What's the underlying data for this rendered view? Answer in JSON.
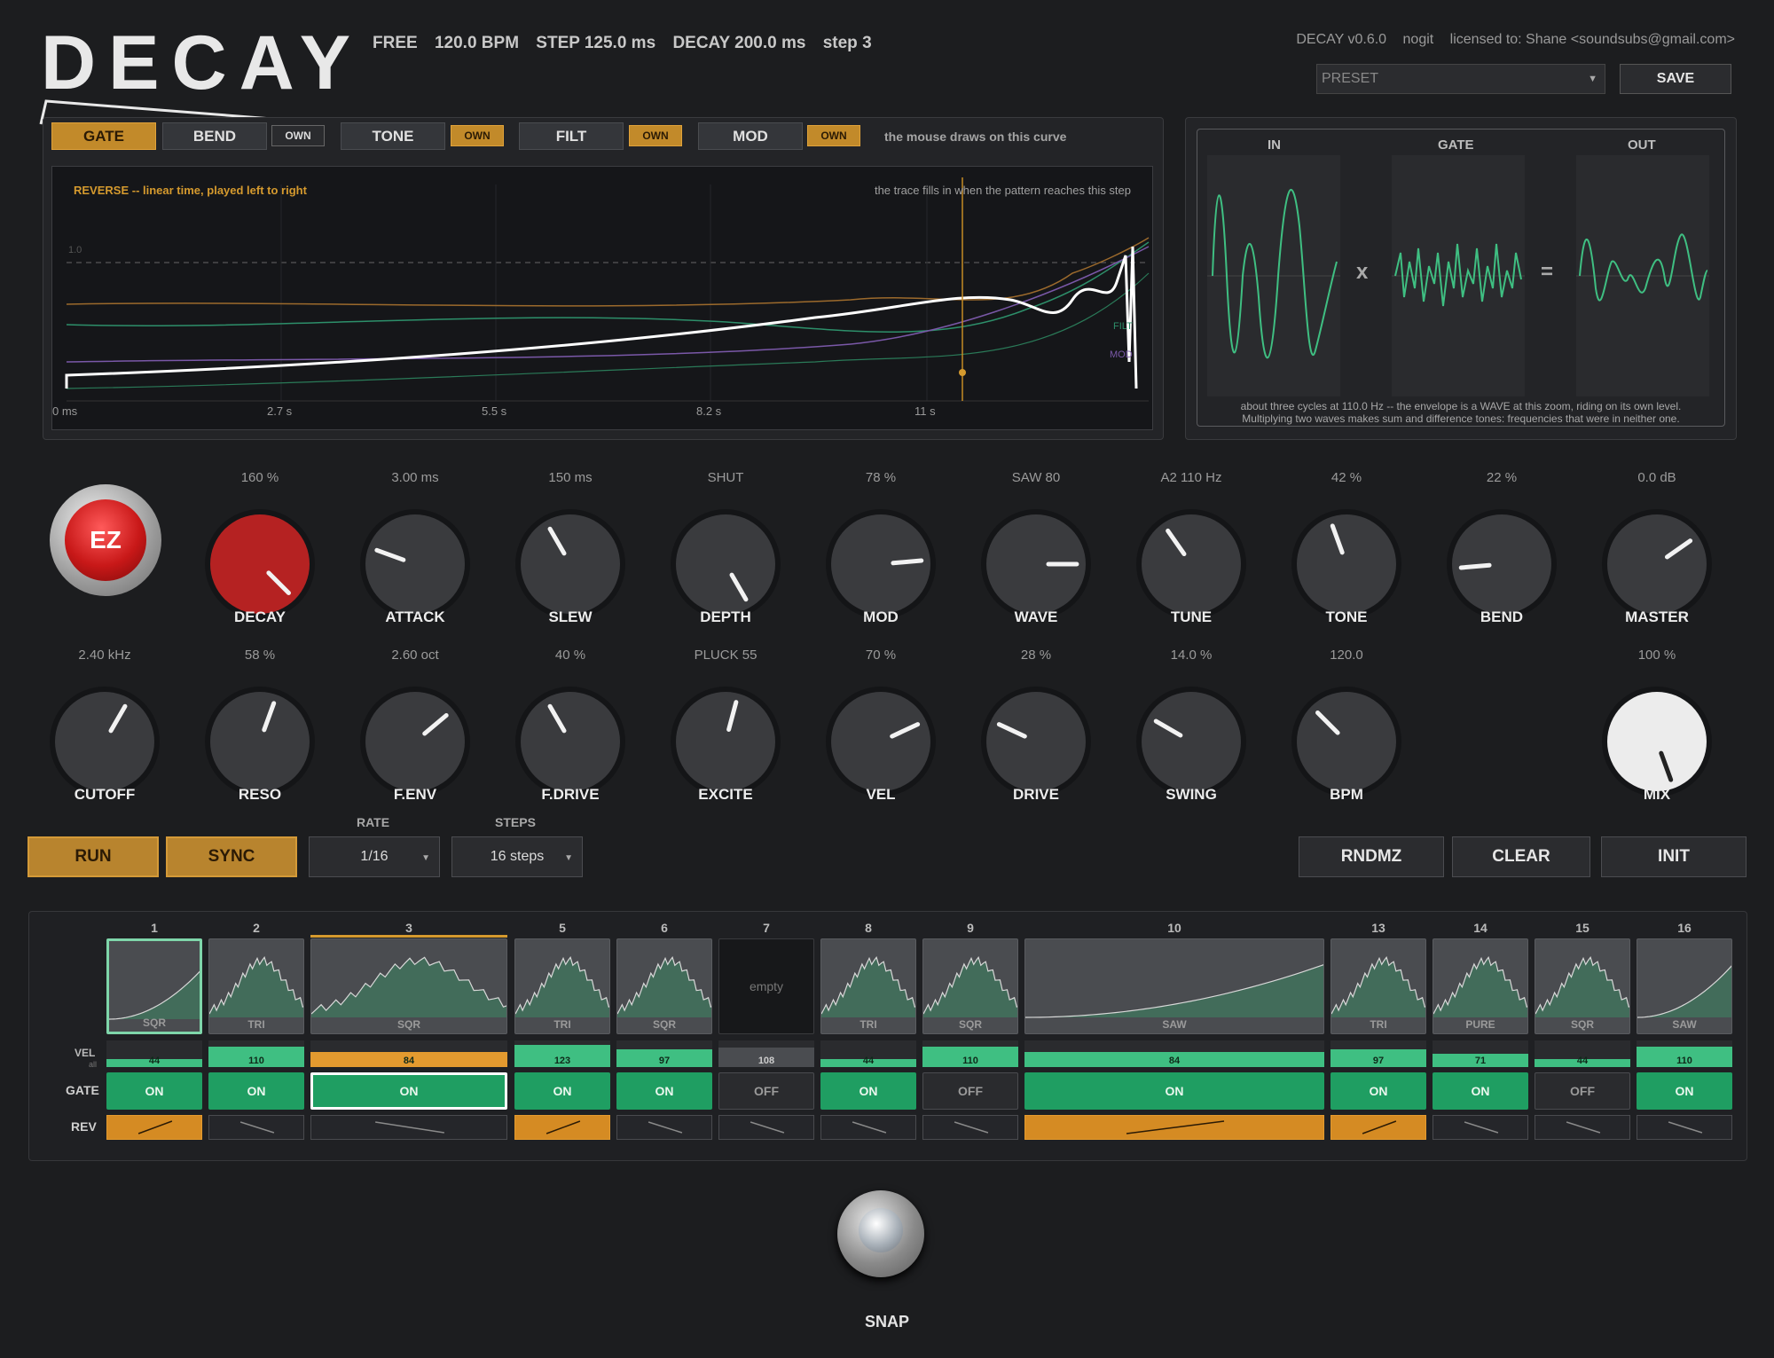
{
  "header": {
    "logo": "DECAY",
    "status": [
      "FREE",
      "120.0 BPM",
      "STEP 125.0 ms",
      "DECAY 200.0 ms",
      "step 3"
    ],
    "info": [
      "DECAY  v0.6.0",
      "nogit",
      "licensed to: Shane <soundsubs@gmail.com>"
    ],
    "preset_placeholder": "PRESET",
    "save_label": "SAVE"
  },
  "tabs": [
    {
      "label": "GATE",
      "active": true
    },
    {
      "label": "BEND",
      "own": "OWN",
      "own_on": false
    },
    {
      "label": "TONE",
      "own": "OWN",
      "own_on": true
    },
    {
      "label": "FILT",
      "own": "OWN",
      "own_on": true
    },
    {
      "label": "MOD",
      "own": "OWN",
      "own_on": true
    }
  ],
  "tabs_hint": "the mouse draws on this curve",
  "curve": {
    "mode_label": "REVERSE  --  linear time, played left to right",
    "hint": "the trace fills in when the pattern reaches this step",
    "y_ref": "1.0",
    "x_ticks": [
      "0 ms",
      "2.7 s",
      "5.5 s",
      "8.2 s",
      "11 s"
    ],
    "series_labels": [
      "FILT",
      "MOD"
    ]
  },
  "scope": {
    "in_label": "IN",
    "gate_label": "GATE",
    "out_label": "OUT",
    "times": "x",
    "equals": "=",
    "note1": "about three cycles at 110.0 Hz  --  the envelope is a WAVE at this zoom, riding on its own level.",
    "note2": "Multiplying two waves makes sum and difference tones: frequencies that were in neither one."
  },
  "knobs_row1": [
    {
      "label": "DECAY",
      "value": "160 %",
      "style": "red"
    },
    {
      "label": "ATTACK",
      "value": "3.00 ms"
    },
    {
      "label": "SLEW",
      "value": "150 ms"
    },
    {
      "label": "DEPTH",
      "value": "SHUT"
    },
    {
      "label": "MOD",
      "value": "78 %"
    },
    {
      "label": "WAVE",
      "value": "SAW  80"
    },
    {
      "label": "TUNE",
      "value": "A2  110 Hz"
    },
    {
      "label": "TONE",
      "value": "42 %"
    },
    {
      "label": "BEND",
      "value": "22 %"
    },
    {
      "label": "MASTER",
      "value": "0.0 dB"
    }
  ],
  "knobs_row2": [
    {
      "label": "CUTOFF",
      "value": "2.40 kHz"
    },
    {
      "label": "RESO",
      "value": "58 %"
    },
    {
      "label": "F.ENV",
      "value": "2.60 oct"
    },
    {
      "label": "F.DRIVE",
      "value": "40 %"
    },
    {
      "label": "EXCITE",
      "value": "PLUCK 55"
    },
    {
      "label": "VEL",
      "value": "70 %"
    },
    {
      "label": "DRIVE",
      "value": "28 %"
    },
    {
      "label": "SWING",
      "value": "14.0 %"
    },
    {
      "label": "BPM",
      "value": "120.0"
    },
    {
      "label": "MIX",
      "value": "100 %",
      "style": "white"
    }
  ],
  "ez_label": "EZ",
  "transport": {
    "run": "RUN",
    "sync": "SYNC",
    "rate_label": "RATE",
    "rate_value": "1/16",
    "steps_label": "STEPS",
    "steps_value": "16 steps",
    "rndmz": "RNDMZ",
    "clear": "CLEAR",
    "init": "INIT"
  },
  "seq": {
    "vel_label": "VEL",
    "vel_sub": "all",
    "gate_label": "GATE",
    "rev_label": "REV",
    "steps": [
      {
        "num": "1",
        "wave": "SQR",
        "vel": 44,
        "gate": "ON",
        "rev": true
      },
      {
        "num": "2",
        "wave": "TRI",
        "vel": 110,
        "gate": "ON",
        "rev": false
      },
      {
        "num": "3",
        "wave": "SQR",
        "vel": 84,
        "gate": "ON",
        "rev": false
      },
      {
        "num": "5",
        "wave": "TRI",
        "vel": 123,
        "gate": "ON",
        "rev": true
      },
      {
        "num": "6",
        "wave": "SQR",
        "vel": 97,
        "gate": "ON",
        "rev": false
      },
      {
        "num": "7",
        "wave": "empty",
        "vel": 108,
        "gate": "OFF",
        "rev": false
      },
      {
        "num": "8",
        "wave": "TRI",
        "vel": 44,
        "gate": "ON",
        "rev": false
      },
      {
        "num": "9",
        "wave": "SQR",
        "vel": 110,
        "gate": "OFF",
        "rev": false
      },
      {
        "num": "10",
        "wave": "SAW",
        "vel": 84,
        "gate": "ON",
        "rev": true
      },
      {
        "num": "13",
        "wave": "TRI",
        "vel": 97,
        "gate": "ON",
        "rev": true
      },
      {
        "num": "14",
        "wave": "PURE",
        "vel": 71,
        "gate": "ON",
        "rev": false
      },
      {
        "num": "15",
        "wave": "SQR",
        "vel": 44,
        "gate": "OFF",
        "rev": false
      },
      {
        "num": "16",
        "wave": "SAW",
        "vel": 110,
        "gate": "ON",
        "rev": false
      }
    ]
  },
  "snap_label": "SNAP",
  "colors": {
    "accent": "#c28a2a",
    "green": "#1f9e62",
    "red": "#b52222"
  }
}
